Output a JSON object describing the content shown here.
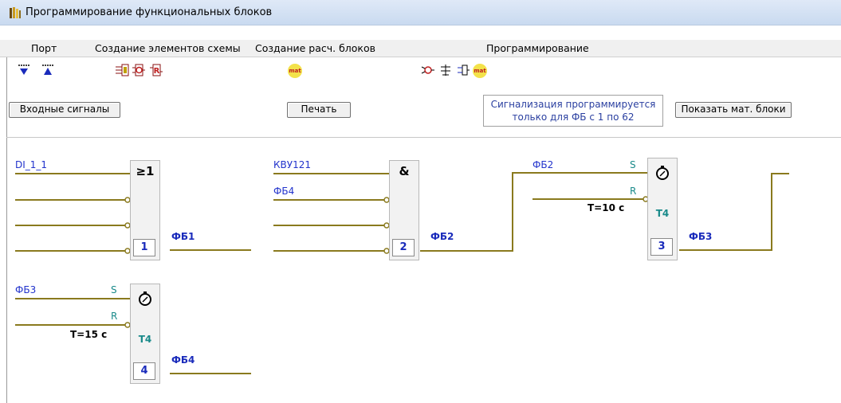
{
  "window": {
    "title": "Программирование функциональных блоков"
  },
  "menu": [
    "Порт",
    "Создание элементов схемы",
    "Создание расч. блоков",
    "Программирование"
  ],
  "toolbar": {
    "icons": [
      "port-input-icon",
      "port-output-icon",
      "element-icon-1",
      "element-icon-2",
      "element-icon-3",
      "mat-block-icon",
      "prog-icon-1",
      "prog-icon-2",
      "prog-icon-3",
      "prog-mat-icon"
    ],
    "mat_label": "mat"
  },
  "buttons": {
    "input_signals": "Входные сигналы",
    "print": "Печать",
    "show_mat": "Показать мат. блоки"
  },
  "note": {
    "line1": "Сигнализация программируется",
    "line2": "только для ФБ с 1 по 62"
  },
  "blocks": [
    {
      "num": "1",
      "op": "≥1",
      "output": "ФБ1",
      "inputs": [
        "DI_1_1",
        "",
        "",
        ""
      ]
    },
    {
      "num": "2",
      "op": "&",
      "output": "ФБ2",
      "inputs": [
        "КВУ121",
        "ФБ4",
        "",
        ""
      ]
    },
    {
      "num": "3",
      "op": "timer",
      "type": "T4",
      "output": "ФБ3",
      "s_input": "ФБ2",
      "s": "S",
      "r": "R",
      "time": "T=10 с"
    },
    {
      "num": "4",
      "op": "timer",
      "type": "T4",
      "output": "ФБ4",
      "s_input": "ФБ3",
      "s": "S",
      "r": "R",
      "time": "T=15 с"
    }
  ],
  "colors": {
    "wire": "#8a7a1e",
    "signal_text": "#2233cc",
    "timer_text": "#1a8a8a"
  }
}
